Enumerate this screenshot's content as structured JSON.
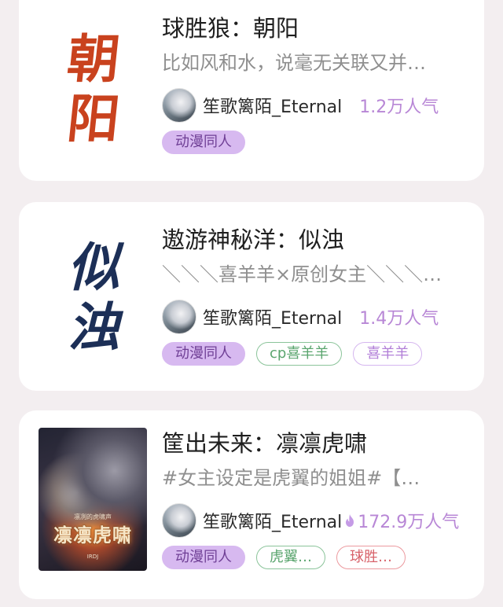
{
  "works": [
    {
      "cover_text": [
        "朝",
        "阳"
      ],
      "title": "球胜狼：朝阳",
      "description": "比如风和水，说毫无关联又并…",
      "author": "笙歌篱陌_Eternal",
      "popularity": "1.2万人气",
      "tags": [
        "动漫同人"
      ]
    },
    {
      "cover_text": [
        "似",
        "浊"
      ],
      "title": "遨游神秘洋：似浊",
      "description": "＼＼＼喜羊羊×原创女主＼＼＼…",
      "author": "笙歌篱陌_Eternal",
      "popularity": "1.4万人气",
      "tags": [
        "动漫同人",
        "cp喜羊羊",
        "喜羊羊"
      ]
    },
    {
      "cover_text": [
        "凛凛虎啸"
      ],
      "cover_small_text": [
        "凛冽的虎啸声",
        "IRDJ"
      ],
      "title": "筐出未来：凛凛虎啸",
      "description": "#女主设定是虎翼的姐姐#【…",
      "author": "笙歌篱陌_Eternal",
      "popularity": "172.9万人气",
      "hot_icon": "flame-icon",
      "tags": [
        "动漫同人",
        "虎翼…",
        "球胜…"
      ]
    }
  ],
  "colors": {
    "background": "#f3eef0",
    "popularity": "#b887d6",
    "tag_filled": "#d7b9f0",
    "tag_green": "#5aa56e",
    "tag_purple": "#b27fd8",
    "tag_red": "#d8626a"
  }
}
